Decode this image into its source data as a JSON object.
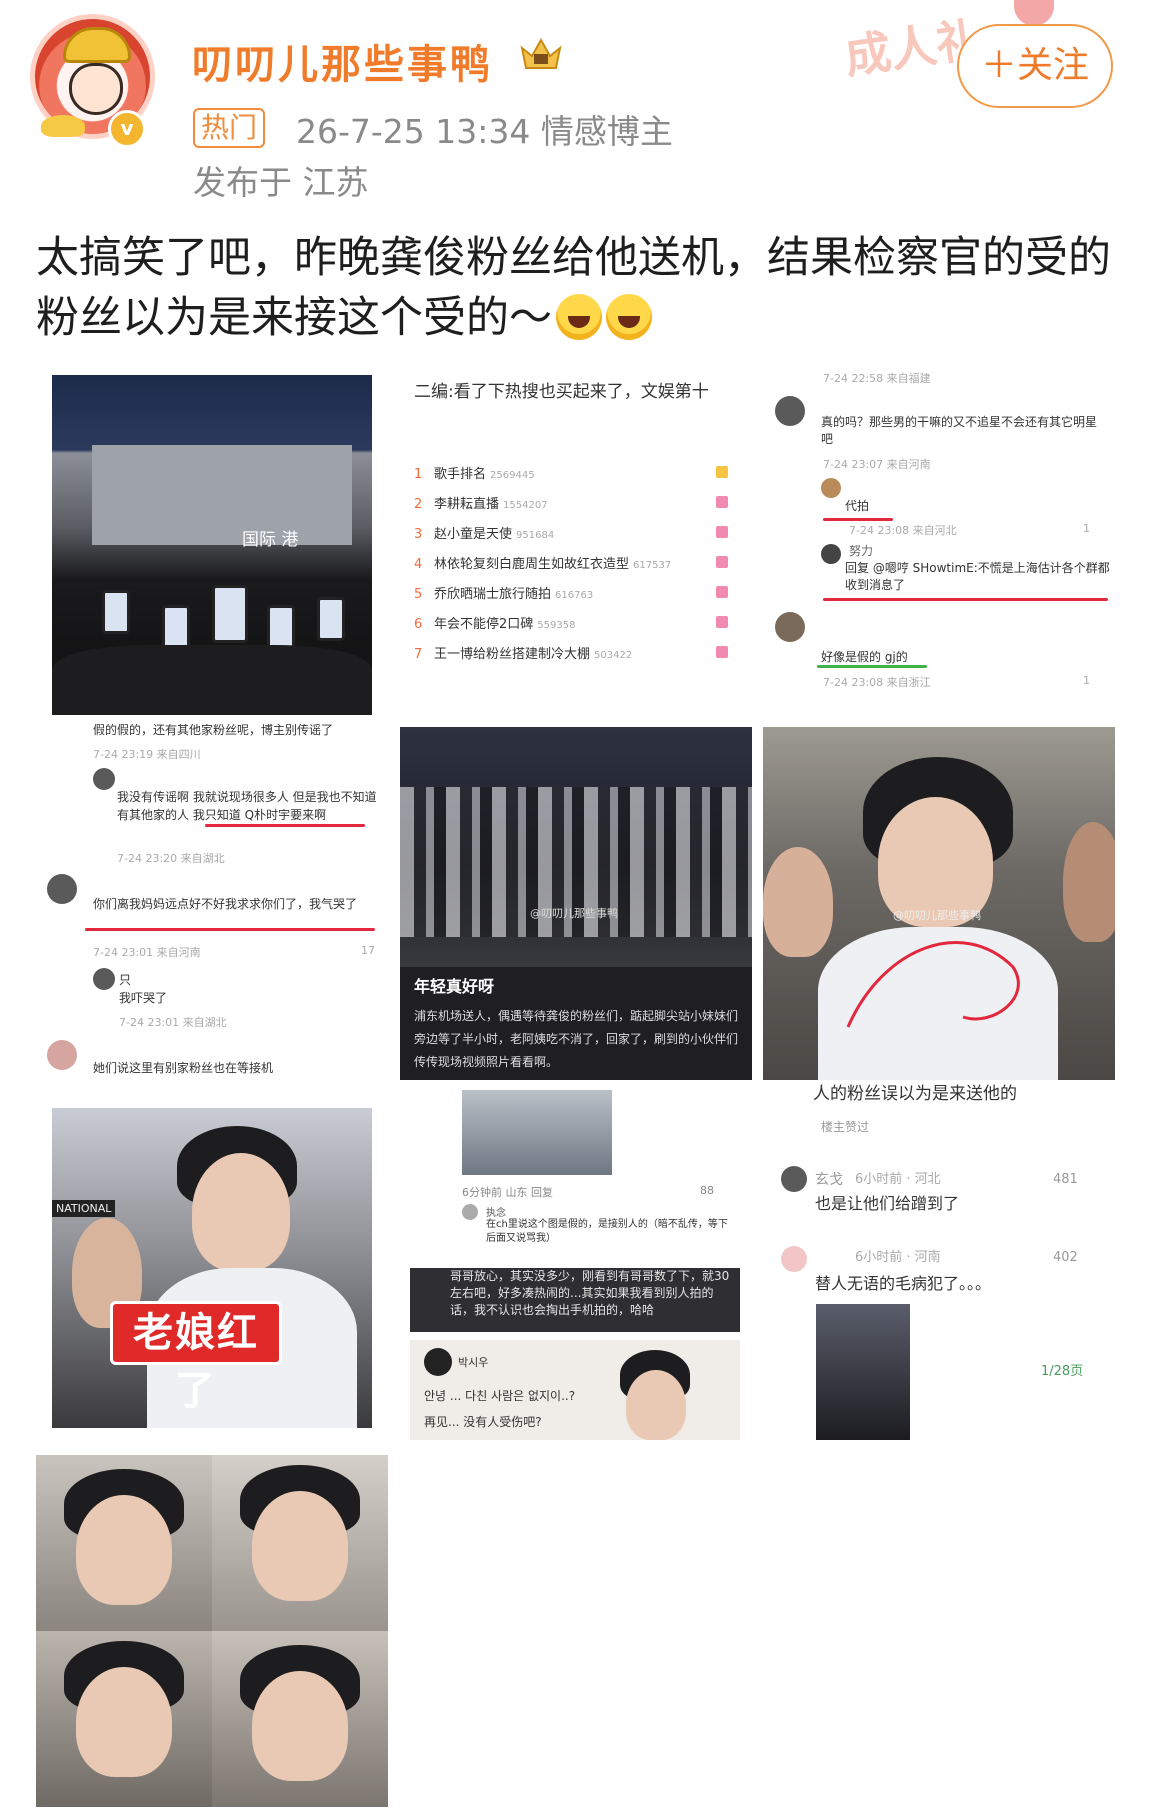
{
  "header": {
    "username": "叨叨儿那些事鸭",
    "hot_tag": "热门",
    "time_category": "26-7-25 13:34  情感博主",
    "location": "发布于 江苏",
    "stamp_text": "成人礼",
    "follow_label": "＋关注"
  },
  "post": {
    "text": "太搞笑了吧，昨晚龚俊粉丝给他送机，结果检察官的受的粉丝以为是来接这个受的～"
  },
  "images": {
    "img1": {
      "sign": "国际 港"
    },
    "img2": {
      "title": "二编:看了下热搜也买起来了，文娱第十",
      "hotlist": [
        {
          "rank": "1",
          "title": "歌手排名",
          "count": "2569445"
        },
        {
          "rank": "2",
          "title": "李耕耘直播",
          "count": "1554207"
        },
        {
          "rank": "3",
          "title": "赵小童是天使",
          "count": "951684"
        },
        {
          "rank": "4",
          "title": "林依轮复刻白鹿周生如故红衣造型",
          "count": "617537"
        },
        {
          "rank": "5",
          "title": "乔欣晒瑞士旅行随拍",
          "count": "616763"
        },
        {
          "rank": "6",
          "title": "年会不能停2口碑",
          "count": "559358"
        },
        {
          "rank": "7",
          "title": "王一博给粉丝搭建制冷大棚",
          "count": "503422"
        }
      ]
    },
    "img3": {
      "c1_meta": "7-24 22:58 来自福建",
      "c1_text": "真的吗？那些男的干嘛的又不追星不会还有其它明星吧",
      "c1_meta2": "7-24 23:07 来自河南",
      "c2_text": "代拍",
      "c2_meta": "7-24 23:08 来自河北",
      "c3_name": "努力",
      "c3_text": "回复 @嗯哼 SHowtimE:不慌是上海估计各个群都收到消息了",
      "c4_text": "好像是假的 gj的",
      "c4_meta": "7-24 23:08 来自浙江",
      "like1": "1",
      "like2": "1"
    },
    "img4": {
      "top_text": "假的假的，还有其他家粉丝呢，博主别传谣了",
      "m1": "7-24 23:19 来自四川",
      "t2": "我没有传谣啊 我就说现场很多人 但是我也不知道有其他家的人 我只知道 Q朴时宇要来啊",
      "m2": "7-24 23:20 来自湖北",
      "t3": "你们离我妈妈远点好不好我求求你们了，我气哭了",
      "m3": "7-24 23:01 来自河南",
      "l3": "17",
      "n4": "只",
      "t4": "我吓哭了",
      "m4": "7-24 23:01 来自湖北",
      "t5": "她们说这里有别家粉丝也在等接机"
    },
    "img5": {
      "watermark": "@叨叨儿那些事鸭",
      "caption_title": "年轻真好呀",
      "caption_body": "浦东机场送人，偶遇等待龚俊的粉丝们，踮起脚尖站小妹妹们旁边等了半小时，老阿姨吃不消了，回家了，刷到的小伙伴们传传现场视频照片看看啊。"
    },
    "img6": {
      "watermark": "@叨叨儿那些事鸭",
      "text": "人的粉丝误以为是来送他的",
      "op_tag": "楼主赞过",
      "c1_name": "玄戈",
      "c1_meta": "6小时前 · 河北",
      "c1_likes": "481",
      "c1_text": "也是让他们给蹭到了",
      "c2_meta": "6小时前 · 河南",
      "c2_likes": "402",
      "c2_text": "替人无语的毛病犯了。。。",
      "page": "1/28页"
    },
    "img7": {
      "caption": "老娘红了",
      "sign": "NATIONAL"
    },
    "img8": {
      "meta": "6分钟前 山东 回复",
      "likes": "88",
      "name": "执念",
      "text": "在ch里说这个图是假的，是接别人的（暗不乱传，等下后面又说骂我）",
      "panel_text": "哥哥放心，其实没多少，刚看到有哥哥数了下，就30左右吧，好多凑热闹的...其实如果我看到别人拍的话，我不认识也会掏出手机拍的，哈哈",
      "kr_name": "박시우",
      "kr_line": "안녕 ... 다친 사람은 없지이..?",
      "cn_line": "再见... 没有人受伤吧?"
    },
    "img9": {}
  },
  "colors": {
    "brand_orange": "#f07c2b",
    "meta_gray": "#8a8a8a",
    "underline_red": "#e3283d",
    "underline_green": "#3fb34a"
  }
}
